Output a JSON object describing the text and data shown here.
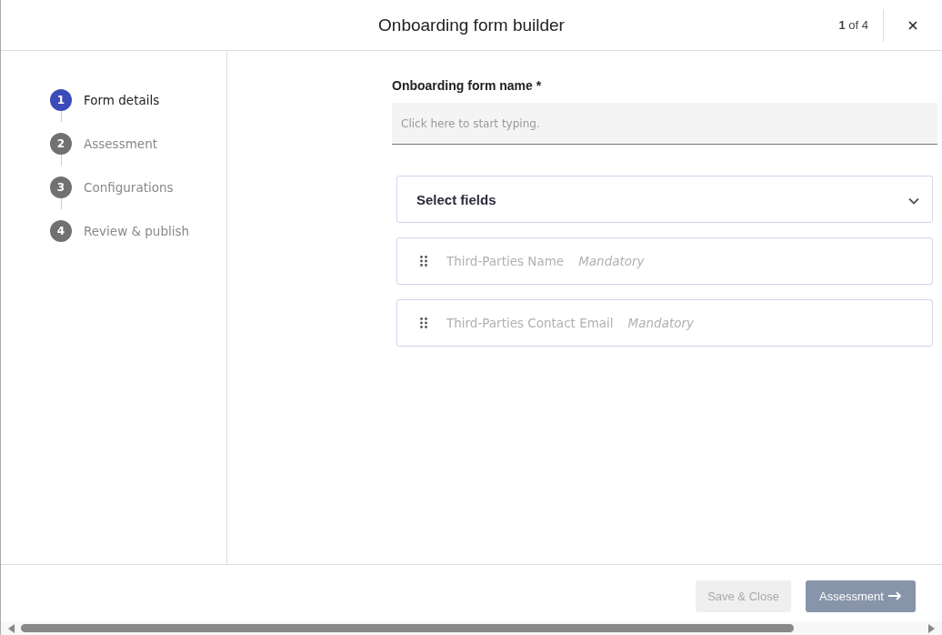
{
  "window": {
    "title": "Onboarding form builder",
    "page_counter": "**1** of 4"
  },
  "steps": [
    {
      "number": "1",
      "label": "Form details",
      "selected": true
    },
    {
      "number": "2",
      "label": "Assessment",
      "selected": false
    },
    {
      "number": "3",
      "label": "Configurations",
      "selected": false
    },
    {
      "number": "4",
      "label": "Review & publish",
      "selected": false
    }
  ],
  "form_name": {
    "label": "Onboarding form name *",
    "placeholder": "Click here to start typing."
  },
  "select_fields": {
    "label": "Select fields",
    "expanded": false
  },
  "fields": [
    {
      "name": "Third-Parties Name",
      "tag": "Mandatory"
    },
    {
      "name": "Third-Parties Contact Email",
      "tag": "Mandatory"
    }
  ],
  "footer": {
    "buttons": [
      {
        "label": "Save & Close",
        "kind": "secondary",
        "disabled": true
      },
      {
        "label": "Assessment",
        "kind": "next"
      }
    ]
  }
}
